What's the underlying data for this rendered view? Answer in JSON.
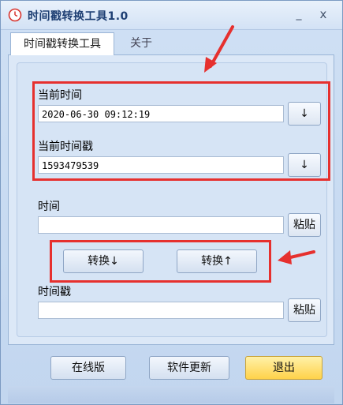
{
  "window": {
    "title": "时间戳转换工具1.0",
    "minimize_glyph": "_",
    "close_glyph": "x"
  },
  "tabs": [
    {
      "label": "时间戳转换工具"
    },
    {
      "label": "关于"
    }
  ],
  "current_time": {
    "label": "当前时间",
    "value": "2020-06-30 09:12:19",
    "button": "↓"
  },
  "current_timestamp": {
    "label": "当前时间戳",
    "value": "1593479539",
    "button": "↓"
  },
  "time_input": {
    "label": "时间",
    "value": "",
    "paste_label": "粘贴"
  },
  "convert": {
    "to_timestamp": "转换↓",
    "to_time": "转换↑"
  },
  "timestamp_input": {
    "label": "时间戳",
    "value": "",
    "paste_label": "粘贴"
  },
  "footer": {
    "online": "在线版",
    "update": "软件更新",
    "exit": "退出"
  },
  "colors": {
    "annotation": "#e6302e",
    "exit_button": "#ffd24a",
    "title_text": "#1e3f73"
  }
}
